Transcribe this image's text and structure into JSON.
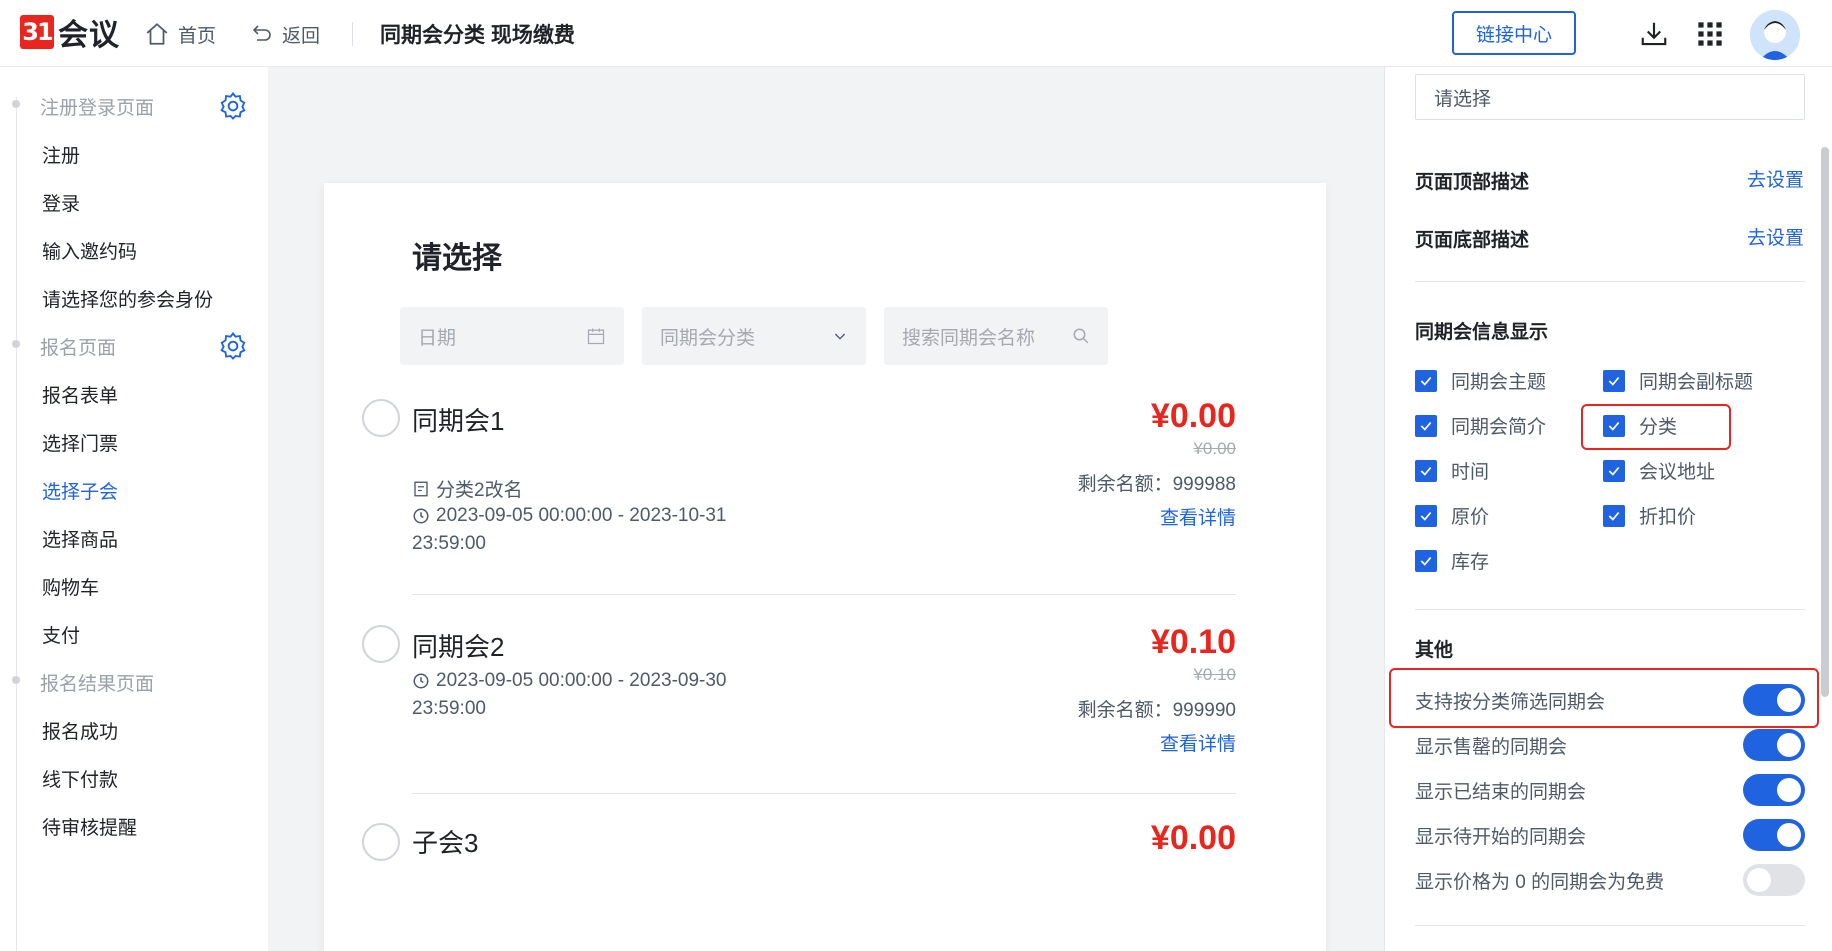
{
  "header": {
    "logo_mark": "31",
    "logo_text": "会议",
    "home_label": "首页",
    "back_label": "返回",
    "page_title": "同期会分类 现场缴费",
    "link_center": "链接中心"
  },
  "sidebar": {
    "groups": [
      {
        "label": "注册登录页面",
        "items": [
          "注册",
          "登录",
          "输入邀约码",
          "请选择您的参会身份"
        ]
      },
      {
        "label": "报名页面",
        "items": [
          "报名表单",
          "选择门票",
          "选择子会",
          "选择商品",
          "购物车",
          "支付"
        ]
      },
      {
        "label": "报名结果页面",
        "items": [
          "报名成功",
          "线下付款",
          "待审核提醒"
        ]
      }
    ],
    "active_item": "选择子会"
  },
  "preview": {
    "title": "请选择",
    "filters": {
      "date_placeholder": "日期",
      "category_placeholder": "同期会分类",
      "search_placeholder": "搜索同期会名称"
    },
    "sessions": [
      {
        "name": "同期会1",
        "category": "分类2改名",
        "time": "2023-09-05 00:00:00 - 2023-10-31",
        "time_cont": "23:59:00",
        "price": "¥0.00",
        "original_price": "¥0.00",
        "stock": "剩余名额：999988",
        "detail": "查看详情"
      },
      {
        "name": "同期会2",
        "time": "2023-09-05 00:00:00 - 2023-09-30",
        "time_cont": "23:59:00",
        "price": "¥0.10",
        "original_price": "¥0.10",
        "stock": "剩余名额：999990",
        "detail": "查看详情"
      },
      {
        "name": "子会3",
        "price": "¥0.00"
      }
    ]
  },
  "panel": {
    "select_value": "请选择",
    "top_desc": "页面顶部描述",
    "bottom_desc": "页面底部描述",
    "set_link": "去设置",
    "info_section": "同期会信息显示",
    "checkboxes": [
      "同期会主题",
      "同期会副标题",
      "同期会简介",
      "分类",
      "时间",
      "会议地址",
      "原价",
      "折扣价",
      "库存"
    ],
    "other_section": "其他",
    "toggles": [
      {
        "label": "支持按分类筛选同期会",
        "on": true
      },
      {
        "label": "显示售罄的同期会",
        "on": true
      },
      {
        "label": "显示已结束的同期会",
        "on": true
      },
      {
        "label": "显示待开始的同期会",
        "on": true
      },
      {
        "label": "显示价格为 0 的同期会为免费",
        "on": false
      }
    ]
  },
  "colors": {
    "accent": "#1f63e0",
    "price": "#e8261e",
    "highlight": "#e8261e"
  }
}
